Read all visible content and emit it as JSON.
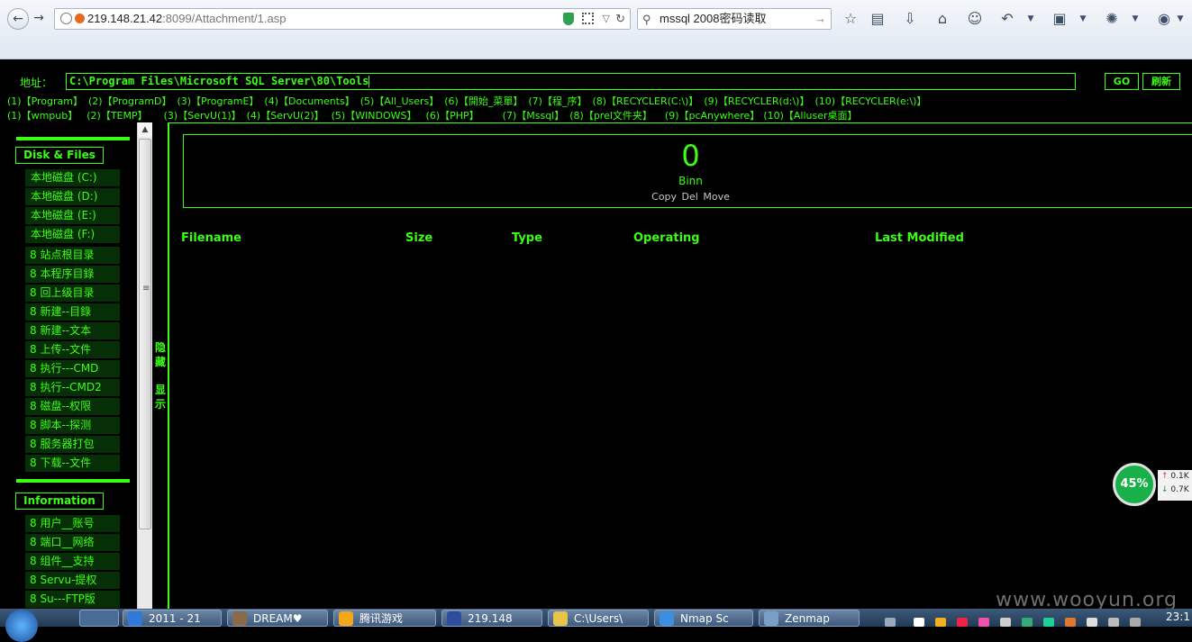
{
  "browser": {
    "url_host": "219.148.21.42",
    "url_rest": ":8099/Attachment/1.asp",
    "search_text": "mssql 2008密码读取"
  },
  "address": {
    "label": "地址：",
    "path": "C:\\Program Files\\Microsoft SQL Server\\80\\Tools",
    "go_label": "GO",
    "refresh_label": "刷新"
  },
  "quick_links_1": [
    "(1)【Program】",
    "(2)【ProgramD】",
    "(3)【ProgramE】",
    "(4)【Documents】",
    "(5)【All_Users】",
    "(6)【開始_菜單】",
    "(7)【程_序】",
    "(8)【RECYCLER(C:\\)】",
    "(9)【RECYCLER(d:\\)】",
    "(10)【RECYCLER(e:\\)】"
  ],
  "quick_links_2": [
    "(1)【wmpub】",
    "(2)【TEMP】",
    "(3)【ServU(1)】",
    "(4)【ServU(2)】",
    "(5)【WINDOWS】",
    "(6)【PHP】",
    "(7)【Mssql】",
    "(8)【prel文件夹】",
    "(9)【pcAnywhere】",
    "(10)【Alluser桌面】"
  ],
  "sidebar": {
    "disk_title": "Disk & Files",
    "disks": [
      "本地磁盘 (C:)",
      "本地磁盘 (D:)",
      "本地磁盘 (E:)",
      "本地磁盘 (F:)"
    ],
    "tools": [
      "8 站点根目录",
      "8 本程序目錄",
      "8 回上级目录",
      "8 新建--目錄",
      "8 新建--文本",
      "8 上传--文件",
      "8 执行---CMD",
      "8 执行--CMD2",
      "8 磁盘--权限",
      "8 脚本--探测",
      "8 服务器打包",
      "8 下载--文件"
    ],
    "info_title": "Information",
    "info": [
      "8 用户__账号",
      "8 端口__网络",
      "8 组件__支持",
      "8 Servu-提权",
      "8 Su---FTP版"
    ],
    "hide_label": "隐藏",
    "show_label": "显示"
  },
  "binn": {
    "count": "0",
    "name": "Binn",
    "actions": [
      "Copy",
      "Del",
      "Move"
    ]
  },
  "table": {
    "headers": [
      "Filename",
      "Size",
      "Type",
      "Operating",
      "Last Modified"
    ]
  },
  "net_widget": {
    "percent": "45%",
    "up": "0.1K",
    "down": "0.7K"
  },
  "taskbar": {
    "items": [
      "2011 - 21",
      "DREAM♥",
      "腾讯游戏",
      "219.148",
      "C:\\Users\\",
      "Nmap Sc",
      "Zenmap"
    ],
    "clock": "23:1"
  },
  "watermark": "www.wooyun.org",
  "colors": {
    "accent": "#39ff14",
    "background": "#000000",
    "menu_bg": "#072f07"
  }
}
